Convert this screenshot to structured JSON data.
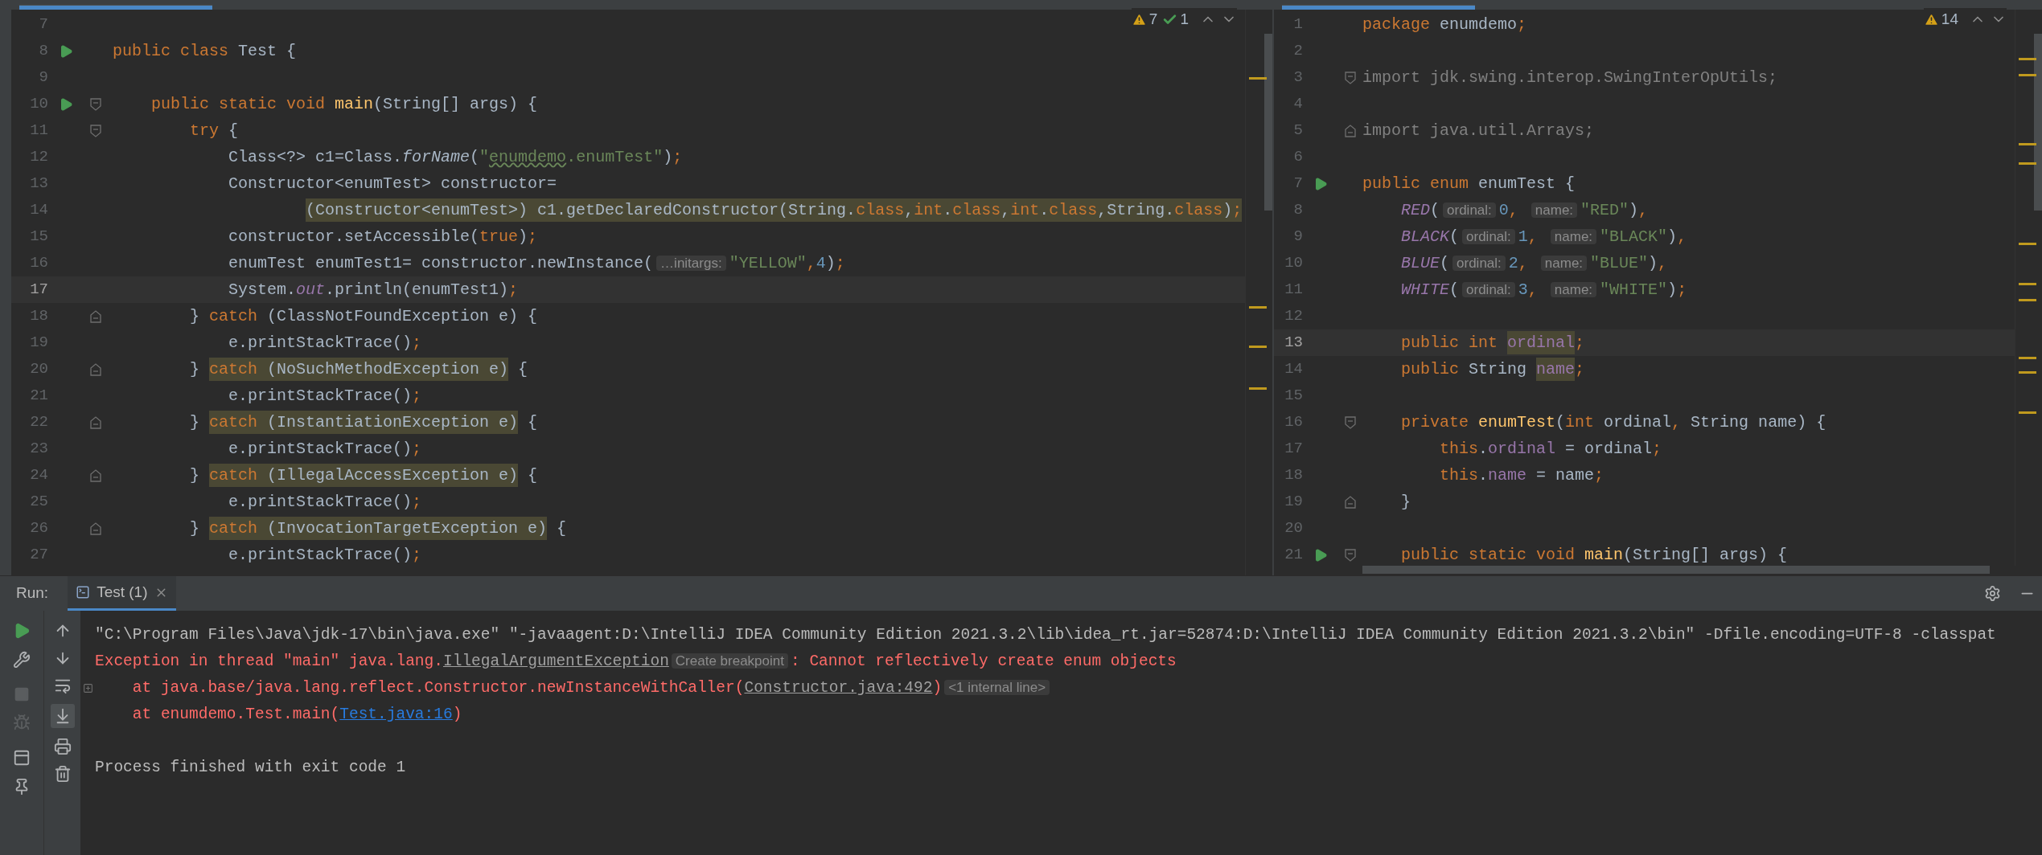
{
  "left_editor": {
    "inspections": [
      {
        "kind": "warning",
        "count": "7"
      },
      {
        "kind": "typo",
        "count": "1"
      }
    ],
    "lines": [
      {
        "number": "7",
        "run": false,
        "current": false
      },
      {
        "number": "8",
        "run": true,
        "current": false,
        "tokens": [
          {
            "kind": "kw",
            "text": "public class "
          },
          {
            "kind": "plain",
            "text": "Test {"
          }
        ]
      },
      {
        "number": "9",
        "run": false,
        "current": false
      },
      {
        "number": "10",
        "run": true,
        "current": false,
        "fold": {
          "kind": "start"
        },
        "tokens": [
          {
            "kind": "kw",
            "text": "    public static void "
          },
          {
            "kind": "method",
            "text": "main"
          },
          {
            "kind": "plain",
            "text": "(String[] args) {"
          }
        ]
      },
      {
        "number": "11",
        "run": false,
        "current": false,
        "fold": {
          "kind": "start"
        },
        "tokens": [
          {
            "kind": "kw",
            "text": "        try"
          },
          {
            "kind": "plain",
            "text": " {"
          }
        ]
      },
      {
        "number": "12",
        "run": false,
        "current": false,
        "tokens": [
          {
            "kind": "plain",
            "text": "            Class<?> c1=Class."
          },
          {
            "kind": "italic",
            "text": "forName"
          },
          {
            "kind": "plain",
            "text": "("
          },
          {
            "kind": "str",
            "text": "\""
          },
          {
            "kind": "typo",
            "text": "enumdemo"
          },
          {
            "kind": "str",
            "text": ".enumTest\""
          },
          {
            "kind": "plain",
            "text": ")"
          },
          {
            "kind": "kw",
            "text": ";"
          }
        ]
      },
      {
        "number": "13",
        "run": false,
        "current": false,
        "tokens": [
          {
            "kind": "plain",
            "text": "            Constructor<enumTest> constructor="
          }
        ]
      },
      {
        "number": "14",
        "run": false,
        "current": false,
        "indented": true,
        "tokens": [
          {
            "kind": "match",
            "tokens": [
              {
                "kind": "plain",
                "text": "(Constructor<enumTest>) c1.getDeclaredConstructor(String."
              },
              {
                "kind": "kw",
                "text": "class"
              },
              {
                "kind": "plain",
                "text": ","
              },
              {
                "kind": "kw",
                "text": "int"
              },
              {
                "kind": "plain",
                "text": "."
              },
              {
                "kind": "kw",
                "text": "class"
              },
              {
                "kind": "plain",
                "text": ","
              },
              {
                "kind": "kw",
                "text": "int"
              },
              {
                "kind": "plain",
                "text": "."
              },
              {
                "kind": "kw",
                "text": "class"
              },
              {
                "kind": "plain",
                "text": ",String."
              },
              {
                "kind": "kw",
                "text": "class"
              },
              {
                "kind": "plain",
                "text": ")"
              },
              {
                "kind": "kw",
                "text": ";"
              }
            ]
          }
        ]
      },
      {
        "number": "15",
        "run": false,
        "current": false,
        "tokens": [
          {
            "kind": "plain",
            "text": "            constructor.setAccessible("
          },
          {
            "kind": "kw",
            "text": "true"
          },
          {
            "kind": "plain",
            "text": ")"
          },
          {
            "kind": "kw",
            "text": ";"
          }
        ]
      },
      {
        "number": "16",
        "run": false,
        "current": false,
        "tokens": [
          {
            "kind": "plain",
            "text": "            enumTest enumTest1= constructor.newInstance("
          },
          {
            "kind": "hint",
            "text": "…initargs:"
          },
          {
            "kind": "str",
            "text": "\"YELLOW\""
          },
          {
            "kind": "kw",
            "text": ","
          },
          {
            "kind": "num",
            "text": "4"
          },
          {
            "kind": "plain",
            "text": ")"
          },
          {
            "kind": "kw",
            "text": ";"
          }
        ]
      },
      {
        "number": "17",
        "run": false,
        "current": true,
        "tokens": [
          {
            "kind": "plain",
            "text": "            System."
          },
          {
            "kind": "static",
            "text": "out"
          },
          {
            "kind": "plain",
            "text": ".println(enumTest1)"
          },
          {
            "kind": "kw",
            "text": ";"
          }
        ]
      },
      {
        "number": "18",
        "run": false,
        "current": false,
        "fold": {
          "kind": "end"
        },
        "tokens": [
          {
            "kind": "plain",
            "text": "        } "
          },
          {
            "kind": "kw",
            "text": "catch"
          },
          {
            "kind": "plain",
            "text": " (ClassNotFoundException e) {"
          }
        ]
      },
      {
        "number": "19",
        "run": false,
        "current": false,
        "tokens": [
          {
            "kind": "plain",
            "text": "            e.printStackTrace()"
          },
          {
            "kind": "kw",
            "text": ";"
          }
        ]
      },
      {
        "number": "20",
        "run": false,
        "current": false,
        "fold": {
          "kind": "end"
        },
        "tokens": [
          {
            "kind": "plain",
            "text": "        } "
          },
          {
            "kind": "match",
            "tokens": [
              {
                "kind": "kw",
                "text": "catch"
              },
              {
                "kind": "plain",
                "text": " (NoSuchMethodException e)"
              }
            ]
          },
          {
            "kind": "plain",
            "text": " {"
          }
        ]
      },
      {
        "number": "21",
        "run": false,
        "current": false,
        "tokens": [
          {
            "kind": "plain",
            "text": "            e.printStackTrace()"
          },
          {
            "kind": "kw",
            "text": ";"
          }
        ]
      },
      {
        "number": "22",
        "run": false,
        "current": false,
        "fold": {
          "kind": "end"
        },
        "tokens": [
          {
            "kind": "plain",
            "text": "        } "
          },
          {
            "kind": "match",
            "tokens": [
              {
                "kind": "kw",
                "text": "catch"
              },
              {
                "kind": "plain",
                "text": " (InstantiationException e)"
              }
            ]
          },
          {
            "kind": "plain",
            "text": " {"
          }
        ]
      },
      {
        "number": "23",
        "run": false,
        "current": false,
        "tokens": [
          {
            "kind": "plain",
            "text": "            e.printStackTrace()"
          },
          {
            "kind": "kw",
            "text": ";"
          }
        ]
      },
      {
        "number": "24",
        "run": false,
        "current": false,
        "fold": {
          "kind": "end"
        },
        "tokens": [
          {
            "kind": "plain",
            "text": "        } "
          },
          {
            "kind": "match",
            "tokens": [
              {
                "kind": "kw",
                "text": "catch"
              },
              {
                "kind": "plain",
                "text": " (IllegalAccessException e)"
              }
            ]
          },
          {
            "kind": "plain",
            "text": " {"
          }
        ]
      },
      {
        "number": "25",
        "run": false,
        "current": false,
        "tokens": [
          {
            "kind": "plain",
            "text": "            e.printStackTrace()"
          },
          {
            "kind": "kw",
            "text": ";"
          }
        ]
      },
      {
        "number": "26",
        "run": false,
        "current": false,
        "fold": {
          "kind": "end"
        },
        "tokens": [
          {
            "kind": "plain",
            "text": "        } "
          },
          {
            "kind": "match",
            "tokens": [
              {
                "kind": "kw",
                "text": "catch"
              },
              {
                "kind": "plain",
                "text": " (InvocationTargetException e)"
              }
            ]
          },
          {
            "kind": "plain",
            "text": " {"
          }
        ]
      },
      {
        "number": "27",
        "run": false,
        "current": false,
        "tokens": [
          {
            "kind": "plain",
            "text": "            e.printStackTrace()"
          },
          {
            "kind": "kw",
            "text": ";"
          }
        ]
      }
    ]
  },
  "right_editor": {
    "inspections": [
      {
        "kind": "warning",
        "count": "14"
      }
    ],
    "lines": [
      {
        "number": "1",
        "run": false,
        "current": false,
        "tokens": [
          {
            "kind": "kw",
            "text": "package "
          },
          {
            "kind": "plain",
            "text": "enumdemo"
          },
          {
            "kind": "kw",
            "text": ";"
          }
        ]
      },
      {
        "number": "2",
        "run": false,
        "current": false
      },
      {
        "number": "3",
        "run": false,
        "current": false,
        "fold": {
          "kind": "start"
        },
        "tokens": [
          {
            "kind": "unused",
            "text": "import jdk.swing.interop.SwingInterOpUtils;"
          }
        ]
      },
      {
        "number": "4",
        "run": false,
        "current": false
      },
      {
        "number": "5",
        "run": false,
        "current": false,
        "fold": {
          "kind": "end"
        },
        "tokens": [
          {
            "kind": "unused",
            "text": "import java.util.Arrays;"
          }
        ]
      },
      {
        "number": "6",
        "run": false,
        "current": false
      },
      {
        "number": "7",
        "run": true,
        "current": false,
        "tokens": [
          {
            "kind": "kw",
            "text": "public enum "
          },
          {
            "kind": "plain",
            "text": "enumTest {"
          }
        ]
      },
      {
        "number": "8",
        "run": false,
        "current": false,
        "tokens": [
          {
            "kind": "static",
            "text": "    RED"
          },
          {
            "kind": "plain",
            "text": "("
          },
          {
            "kind": "hint",
            "text": "ordinal:"
          },
          {
            "kind": "num",
            "text": "0"
          },
          {
            "kind": "kw",
            "text": ", "
          },
          {
            "kind": "hint",
            "text": "name:"
          },
          {
            "kind": "str",
            "text": "\"RED\""
          },
          {
            "kind": "plain",
            "text": ")"
          },
          {
            "kind": "kw",
            "text": ","
          }
        ]
      },
      {
        "number": "9",
        "run": false,
        "current": false,
        "tokens": [
          {
            "kind": "static",
            "text": "    BLACK"
          },
          {
            "kind": "plain",
            "text": "("
          },
          {
            "kind": "hint",
            "text": "ordinal:"
          },
          {
            "kind": "num",
            "text": "1"
          },
          {
            "kind": "kw",
            "text": ", "
          },
          {
            "kind": "hint",
            "text": "name:"
          },
          {
            "kind": "str",
            "text": "\"BLACK\""
          },
          {
            "kind": "plain",
            "text": ")"
          },
          {
            "kind": "kw",
            "text": ","
          }
        ]
      },
      {
        "number": "10",
        "run": false,
        "current": false,
        "tokens": [
          {
            "kind": "static",
            "text": "    BLUE"
          },
          {
            "kind": "plain",
            "text": "("
          },
          {
            "kind": "hint",
            "text": "ordinal:"
          },
          {
            "kind": "num",
            "text": "2"
          },
          {
            "kind": "kw",
            "text": ", "
          },
          {
            "kind": "hint",
            "text": "name:"
          },
          {
            "kind": "str",
            "text": "\"BLUE\""
          },
          {
            "kind": "plain",
            "text": ")"
          },
          {
            "kind": "kw",
            "text": ","
          }
        ]
      },
      {
        "number": "11",
        "run": false,
        "current": false,
        "tokens": [
          {
            "kind": "static",
            "text": "    WHITE"
          },
          {
            "kind": "plain",
            "text": "("
          },
          {
            "kind": "hint",
            "text": "ordinal:"
          },
          {
            "kind": "num",
            "text": "3"
          },
          {
            "kind": "kw",
            "text": ", "
          },
          {
            "kind": "hint",
            "text": "name:"
          },
          {
            "kind": "str",
            "text": "\"WHITE\""
          },
          {
            "kind": "plain",
            "text": ")"
          },
          {
            "kind": "kw",
            "text": ";"
          }
        ]
      },
      {
        "number": "12",
        "run": false,
        "current": false
      },
      {
        "number": "13",
        "run": false,
        "current": true,
        "tokens": [
          {
            "kind": "kw",
            "text": "    public int "
          },
          {
            "kind": "match",
            "tokens": [
              {
                "kind": "field",
                "text": "ordinal"
              }
            ]
          },
          {
            "kind": "kw",
            "text": ";"
          }
        ]
      },
      {
        "number": "14",
        "run": false,
        "current": false,
        "tokens": [
          {
            "kind": "kw",
            "text": "    public "
          },
          {
            "kind": "plain",
            "text": "String "
          },
          {
            "kind": "match",
            "tokens": [
              {
                "kind": "field",
                "text": "name"
              }
            ]
          },
          {
            "kind": "kw",
            "text": ";"
          }
        ]
      },
      {
        "number": "15",
        "run": false,
        "current": false
      },
      {
        "number": "16",
        "run": false,
        "current": false,
        "fold": {
          "kind": "start"
        },
        "tokens": [
          {
            "kind": "kw",
            "text": "    private "
          },
          {
            "kind": "method",
            "text": "enumTest"
          },
          {
            "kind": "plain",
            "text": "("
          },
          {
            "kind": "kw",
            "text": "int "
          },
          {
            "kind": "plain",
            "text": "ordinal"
          },
          {
            "kind": "kw",
            "text": ", "
          },
          {
            "kind": "plain",
            "text": "String name) {"
          }
        ]
      },
      {
        "number": "17",
        "run": false,
        "current": false,
        "tokens": [
          {
            "kind": "kw",
            "text": "        this"
          },
          {
            "kind": "plain",
            "text": "."
          },
          {
            "kind": "field",
            "text": "ordinal"
          },
          {
            "kind": "plain",
            "text": " = ordinal"
          },
          {
            "kind": "kw",
            "text": ";"
          }
        ]
      },
      {
        "number": "18",
        "run": false,
        "current": false,
        "tokens": [
          {
            "kind": "kw",
            "text": "        this"
          },
          {
            "kind": "plain",
            "text": "."
          },
          {
            "kind": "field",
            "text": "name"
          },
          {
            "kind": "plain",
            "text": " = name"
          },
          {
            "kind": "kw",
            "text": ";"
          }
        ]
      },
      {
        "number": "19",
        "run": false,
        "current": false,
        "fold": {
          "kind": "end"
        },
        "tokens": [
          {
            "kind": "plain",
            "text": "    }"
          }
        ]
      },
      {
        "number": "20",
        "run": false,
        "current": false
      },
      {
        "number": "21",
        "run": true,
        "current": false,
        "fold": {
          "kind": "start"
        },
        "tokens": [
          {
            "kind": "kw",
            "text": "    public static void "
          },
          {
            "kind": "method",
            "text": "main"
          },
          {
            "kind": "plain",
            "text": "(String[] args) {"
          }
        ]
      }
    ]
  },
  "run_panel": {
    "label": "Run:",
    "tabs": [
      {
        "label": "Test (1)",
        "selected": true
      }
    ],
    "console": [
      {
        "foldable": false,
        "segments": [
          {
            "kind": "plain",
            "text": "\"C:\\Program Files\\Java\\jdk-17\\bin\\java.exe\" \"-javaagent:D:\\IntelliJ IDEA Community Edition 2021.3.2\\lib\\idea_rt.jar=52874:D:\\IntelliJ IDEA Community Edition 2021.3.2\\bin\" -Dfile.encoding=UTF-8 -classpat"
          }
        ]
      },
      {
        "foldable": false,
        "segments": [
          {
            "kind": "error",
            "text": "Exception in thread \"main\" java.lang."
          },
          {
            "kind": "link",
            "text": "IllegalArgumentException"
          },
          {
            "kind": "hint",
            "text": "Create breakpoint"
          },
          {
            "kind": "error",
            "text": ": Cannot reflectively create enum objects"
          }
        ]
      },
      {
        "foldable": true,
        "segments": [
          {
            "kind": "error",
            "text": "    at java.base/java.lang.reflect.Constructor.newInstanceWithCaller("
          },
          {
            "kind": "link",
            "text": "Constructor.java:492"
          },
          {
            "kind": "error",
            "text": ")"
          },
          {
            "kind": "hint",
            "text": "<1 internal line>"
          }
        ]
      },
      {
        "foldable": false,
        "segments": [
          {
            "kind": "error",
            "text": "    at enumdemo.Test.main("
          },
          {
            "kind": "source_link",
            "text": "Test.java:16"
          },
          {
            "kind": "error",
            "text": ")"
          }
        ]
      },
      {
        "foldable": false
      },
      {
        "foldable": false,
        "segments": [
          {
            "kind": "plain",
            "text": "Process finished with exit code 1"
          }
        ]
      }
    ]
  }
}
